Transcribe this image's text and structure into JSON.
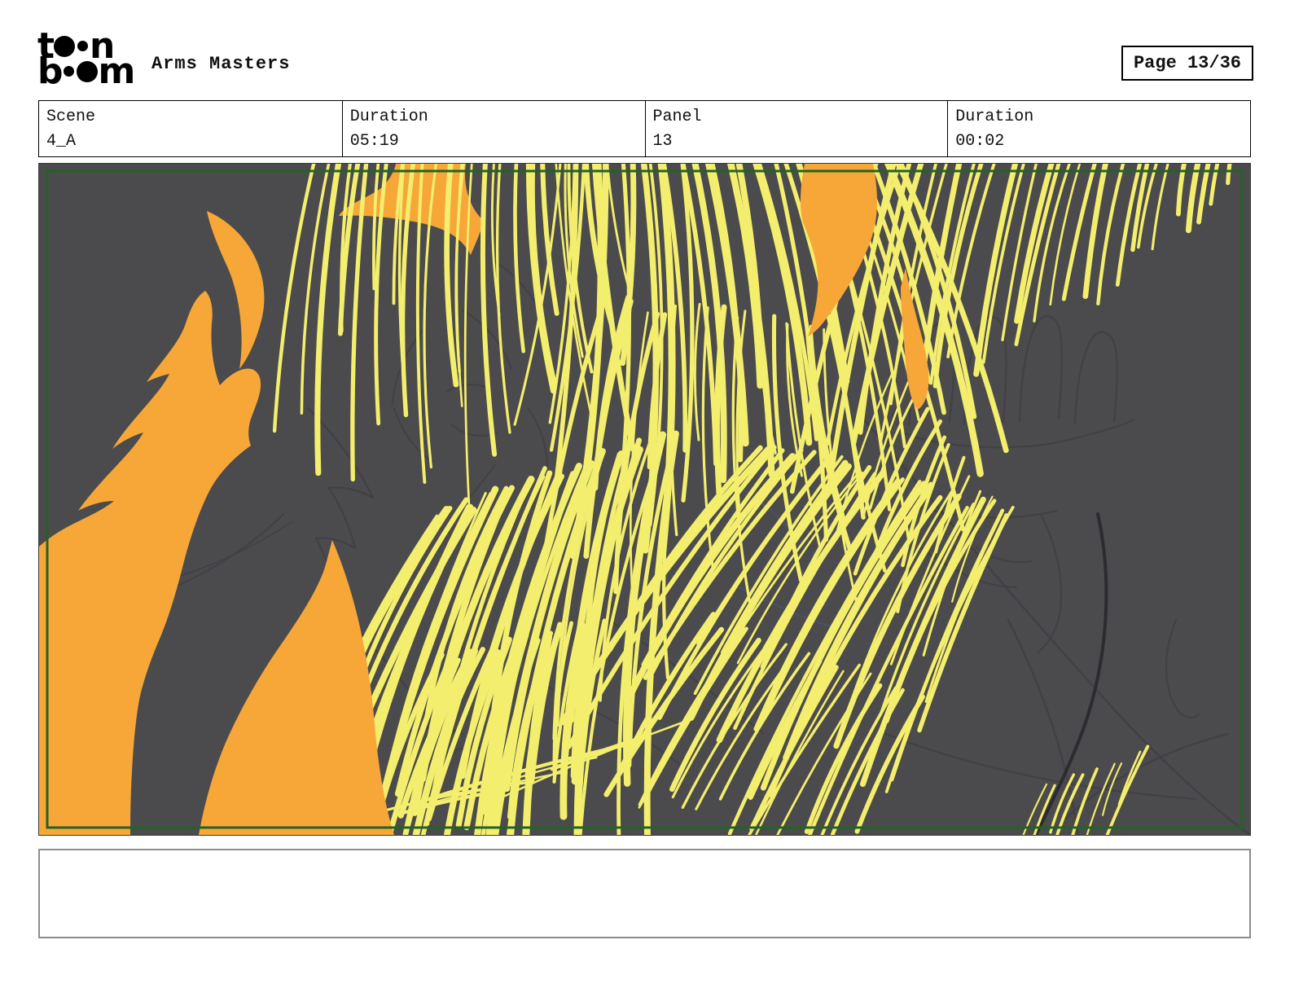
{
  "header": {
    "logo": {
      "t": "t",
      "n": "n",
      "b": "b",
      "m": "m",
      "alt": "toon boom"
    },
    "title": "Arms Masters",
    "page_label": "Page 13/36"
  },
  "info_table": {
    "cells": [
      {
        "label": "Scene",
        "value": "4_A"
      },
      {
        "label": "Duration",
        "value": "05:19"
      },
      {
        "label": "Panel",
        "value": "13"
      },
      {
        "label": "Duration",
        "value": "00:02"
      }
    ]
  },
  "panel": {
    "caption": ""
  },
  "art": {
    "colors": {
      "background": "#4b4b4d",
      "yellow": "#f4ee6e",
      "orange": "#f6a738",
      "frame_green": "#246226",
      "sketch": "#3f3f46",
      "sketch_dark": "#2b2b31",
      "sketch_blue": "#4d5378"
    }
  }
}
